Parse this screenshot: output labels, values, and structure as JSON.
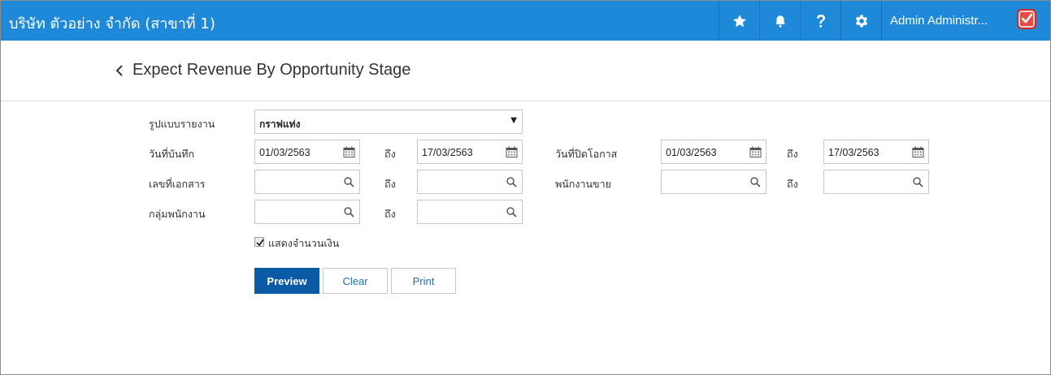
{
  "header": {
    "company": "บริษัท ตัวอย่าง จำกัด (สาขาที่ 1)",
    "user_name": "Admin Administr...",
    "icons": [
      "star-icon",
      "bell-icon",
      "help-icon",
      "gear-icon",
      "shield-check-icon"
    ],
    "accent": "#1e88d9"
  },
  "page": {
    "title": "Expect Revenue By Opportunity Stage"
  },
  "form": {
    "report_format_label": "รูปแบบรายงาน",
    "report_format_value": "กราฟแท่ง",
    "record_date_label": "วันที่บันทึก",
    "record_date_from": "01/03/2563",
    "record_date_to": "17/03/2563",
    "to_label": "ถึง",
    "close_date_label": "วันที่ปิดโอกาส",
    "close_date_from": "01/03/2563",
    "close_date_to": "17/03/2563",
    "doc_no_label": "เลขที่เอกสาร",
    "doc_no_from": "",
    "doc_no_to": "",
    "salesperson_label": "พนักงานขาย",
    "salesperson_from": "",
    "salesperson_to": "",
    "group_label": "กลุ่มพนักงาน",
    "group_from": "",
    "group_to": "",
    "show_amount_label": "แสดงจำนวนเงิน",
    "show_amount_checked": true
  },
  "actions": {
    "preview": "Preview",
    "clear": "Clear",
    "print": "Print"
  }
}
